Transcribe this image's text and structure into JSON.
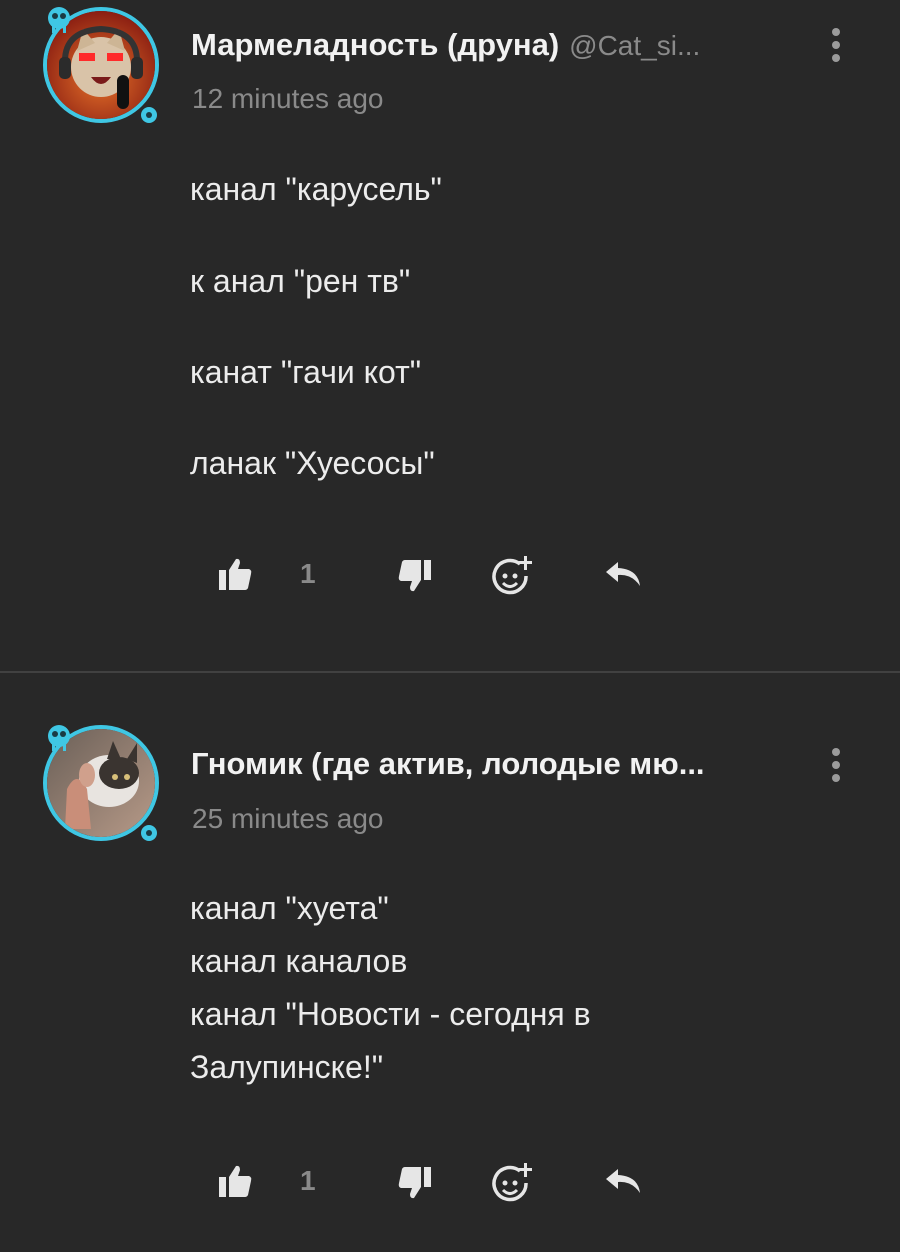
{
  "comments": [
    {
      "author": "Мармеладность (друна)",
      "handle": "@Cat_si...",
      "time": "12 minutes ago",
      "lines": [
        "канал \"карусель\"",
        "к анал \"рен тв\"",
        "канат \"гачи кот\"",
        "ланак \"Хуесосы\""
      ],
      "likes": "1"
    },
    {
      "author": "Гномик (где актив, лолодые мю...",
      "time": "25 minutes ago",
      "lines": [
        "канал \"хуета\"",
        "канал каналов",
        "канал \"Новости - сегодня в",
        "Залупинске!\""
      ],
      "likes": "1"
    }
  ],
  "icons": {
    "like": "thumbs-up-icon",
    "dislike": "thumbs-down-icon",
    "react": "add-reaction-icon",
    "reply": "reply-icon",
    "menu": "more-vertical-icon"
  },
  "colors": {
    "background": "#282828",
    "avatar_ring": "#3fc7e4",
    "text": "#ececec",
    "muted": "#8a8a8a"
  }
}
